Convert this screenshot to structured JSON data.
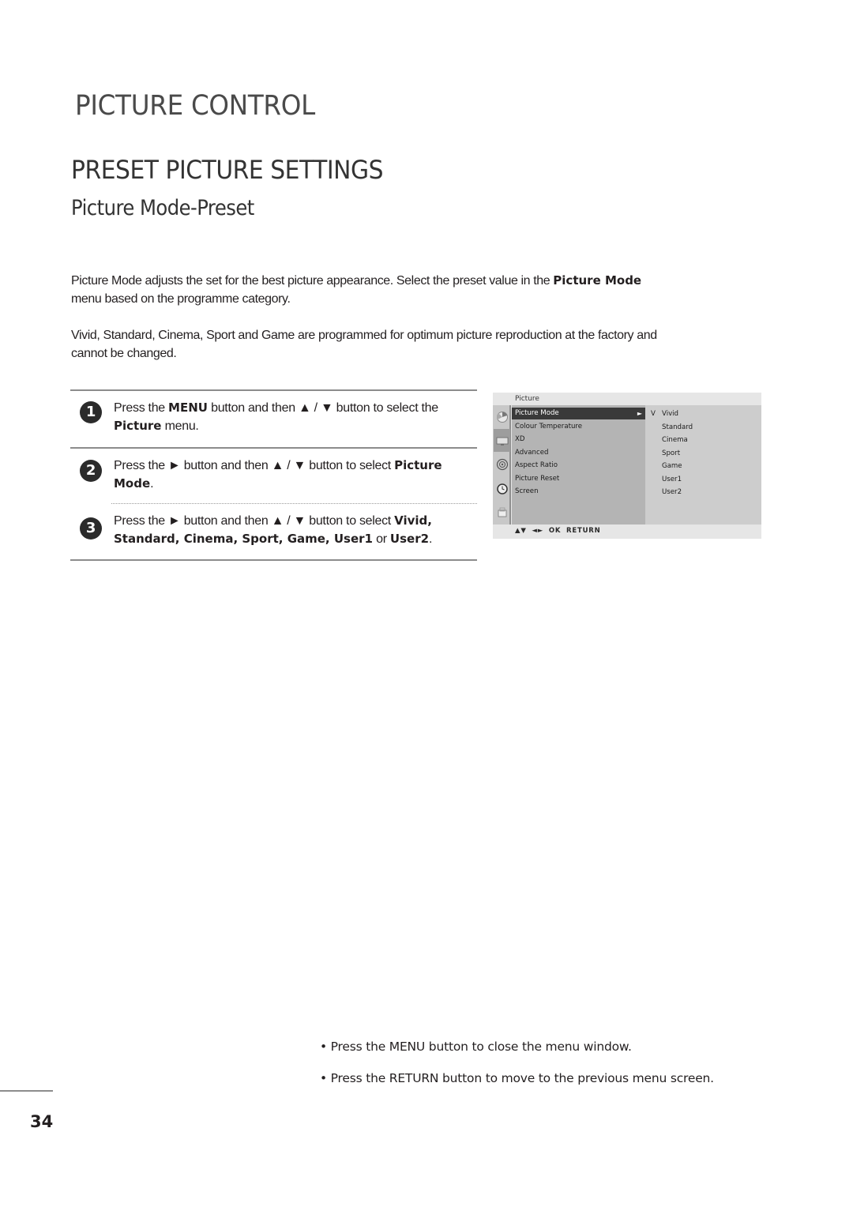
{
  "chapter_title": "PICTURE CONTROL",
  "section_title": "PRESET PICTURE SETTINGS",
  "sub_title": "Picture Mode-Preset",
  "intro": [
    {
      "before": "Picture Mode adjusts the set for the best picture appearance. Select the preset value in the ",
      "bold": "Picture Mode",
      "after": " menu based on the programme category."
    },
    {
      "text": "Vivid, Standard, Cinema, Sport and Game are programmed for optimum picture reproduction at the factory and cannot be changed."
    }
  ],
  "steps": [
    {
      "number": "1",
      "parts": [
        [
          "t",
          "Press the "
        ],
        [
          "b",
          "MENU"
        ],
        [
          "t",
          " button and then ▲ / ▼ button to select the "
        ],
        [
          "b",
          "Picture"
        ],
        [
          "t",
          "  menu."
        ]
      ]
    },
    {
      "number": "2",
      "parts": [
        [
          "t",
          "Press the ► button and then ▲ / ▼ button to select "
        ],
        [
          "b",
          "Picture Mode"
        ],
        [
          "t",
          "."
        ]
      ]
    },
    {
      "number": "3",
      "parts": [
        [
          "t",
          "Press the ► button and then ▲ / ▼ button to select "
        ],
        [
          "b",
          "Vivid, Standard, Cinema, Sport, Game, User1"
        ],
        [
          "t",
          " or "
        ],
        [
          "b",
          "User2"
        ],
        [
          "t",
          "."
        ]
      ]
    }
  ],
  "osd": {
    "header": "Picture",
    "icons": [
      "picture-wheel-icon",
      "tv-screen-icon",
      "speaker-icon",
      "clock-icon",
      "lock-icon"
    ],
    "active_icon_index": 1,
    "items": [
      {
        "label": "Picture Mode",
        "selected": true,
        "arrow": "►"
      },
      {
        "label": "Colour Temperature"
      },
      {
        "label": "XD"
      },
      {
        "label": "Advanced"
      },
      {
        "label": "Aspect Ratio"
      },
      {
        "label": "Picture Reset"
      },
      {
        "label": "Screen"
      }
    ],
    "check_mark": "V",
    "options": [
      "Vivid",
      "Standard",
      "Cinema",
      "Sport",
      "Game",
      "User1",
      "User2"
    ],
    "current_option": "Vivid",
    "footer": "▲▼  ◄►  OK  RETURN"
  },
  "notes": [
    {
      "before": "• Press the ",
      "bold": "MENU",
      "after": " button to close the menu window."
    },
    {
      "before": "• Press the ",
      "bold": "RETURN",
      "after": " button to move to the previous menu screen."
    }
  ],
  "page_number": "34"
}
